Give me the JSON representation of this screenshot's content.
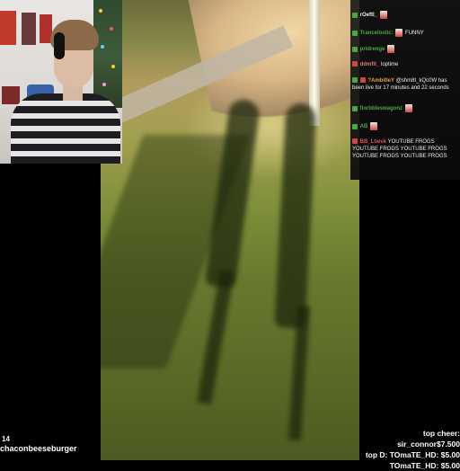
{
  "chat": {
    "messages": [
      {
        "user": "rOeftl_",
        "text": ""
      },
      {
        "user": "Trancelostic:",
        "text": "FUNNY"
      },
      {
        "user": "pridrenge",
        "text": ""
      },
      {
        "user": "ddmfit_",
        "text": "loptime"
      },
      {
        "user": "?AmbitleY",
        "text": "@shm8t_kQc0W has been live for 17 minutes and 22 seconds"
      },
      {
        "user": "florbbleswagonz",
        "text": ""
      },
      {
        "user": "AB",
        "text": ""
      },
      {
        "user": "BB_Lbevk",
        "text": "YOUTUBE FROGS YOUTUBE FROGS YOUTUBE FROGS YOUTUBE FROGS YOUTUBE FROGS"
      }
    ]
  },
  "bottom_left": {
    "count": "14",
    "username": "chaconbeeseburger"
  },
  "cheers": {
    "line1": "top cheer: sir_connor$7.500",
    "line2": "top D: TOmaTE_HD: $5.00",
    "line3": "TOmaTE_HD: $5.00"
  },
  "colors": {
    "mod_badge": "#49a93b",
    "chat_bg": "#141414",
    "accent_red": "#c94b43"
  }
}
